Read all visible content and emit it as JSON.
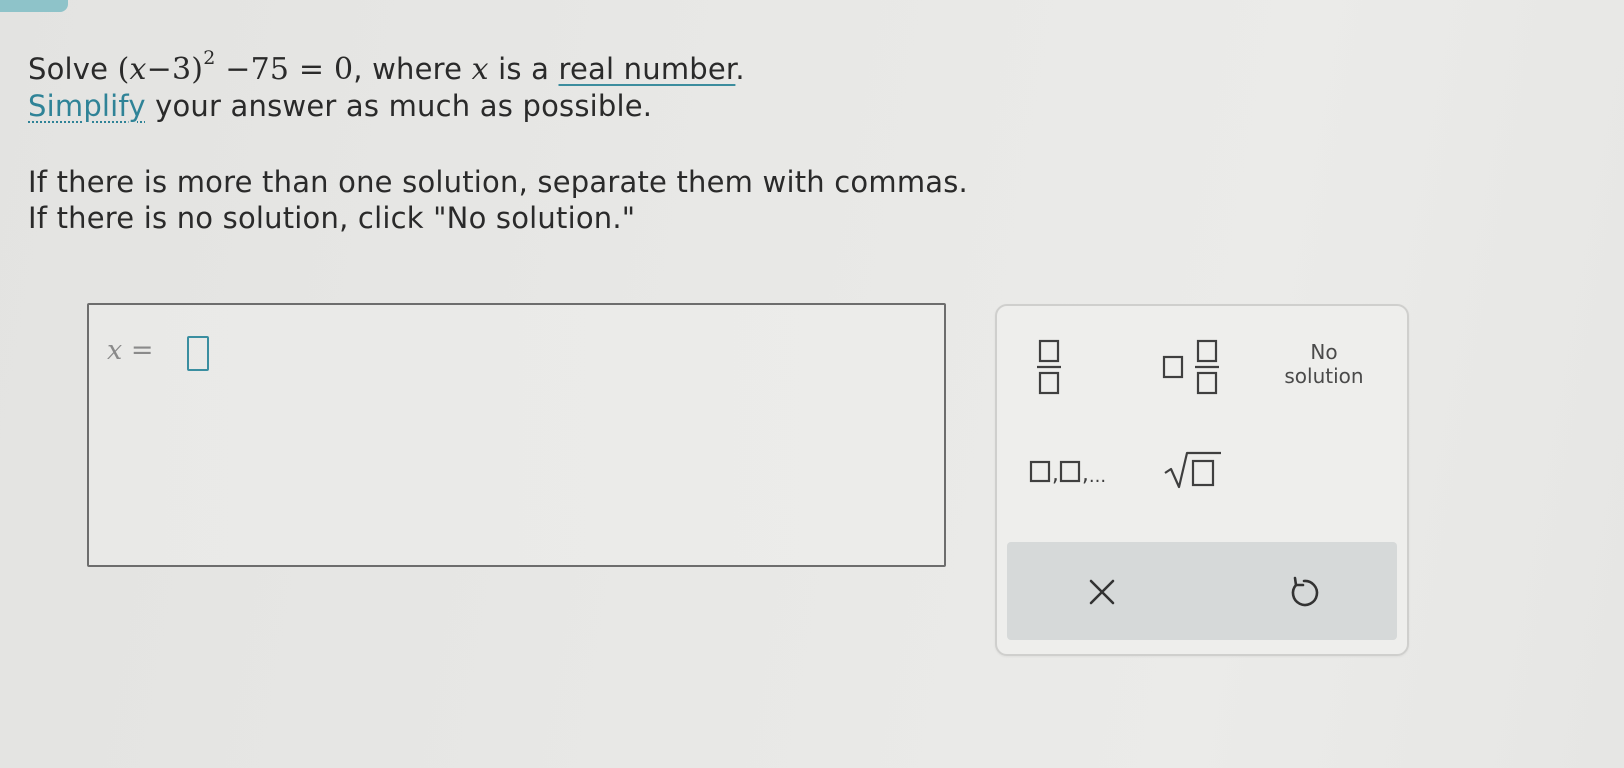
{
  "question": {
    "solve_word": "Solve",
    "equation": {
      "open": "(",
      "variable": "x",
      "minus_inner": "−3)",
      "exponent": "2",
      "rest": " −75 = 0"
    },
    "after_equation": ", where ",
    "variable": "x",
    "is_a": " is a ",
    "real_number_link": "real number",
    "period": ".",
    "simplify_link": "Simplify",
    "simplify_rest": " your answer as much as possible.",
    "instruction_1": "If there is more than one solution, separate them with commas.",
    "instruction_2": "If there is no solution, click \"No solution.\""
  },
  "answer": {
    "variable": "x",
    "equals": "=",
    "value": ""
  },
  "keypad": {
    "no_solution_line1": "No",
    "no_solution_line2": "solution",
    "list_ellipsis": "...",
    "clear_symbol": "×"
  },
  "colors": {
    "accent": "#3a8ea0",
    "link_underline": "#3c8d9e",
    "action_bar": "#d6d9d9"
  }
}
